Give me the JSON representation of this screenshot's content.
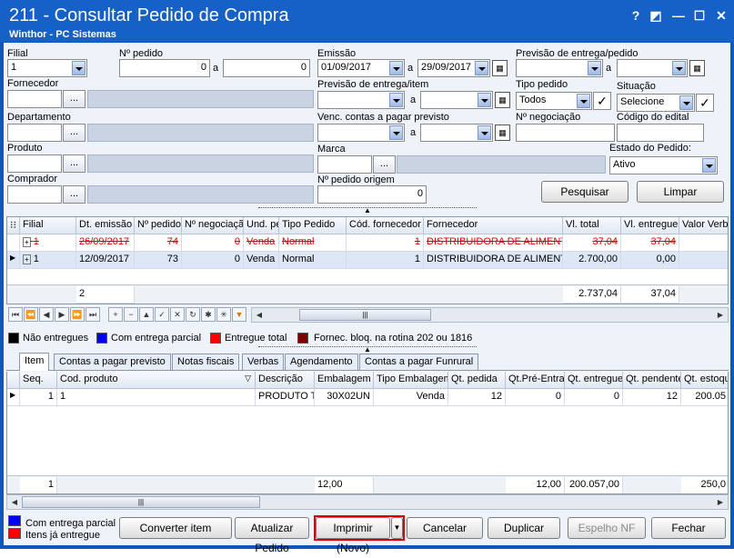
{
  "window": {
    "title": "211 - Consultar Pedido de Compra",
    "subtitle": "Winthor - PC Sistemas",
    "help": "?",
    "restore": "◩",
    "minimize": "—",
    "maximize": "☐",
    "close": "✕"
  },
  "filters": {
    "filial_label": "Filial",
    "filial_value": "1",
    "npedido_label": "Nº pedido",
    "npedido_from": "0",
    "npedido_to": "0",
    "a": "a",
    "emissao_label": "Emissão",
    "emissao_from": "01/09/2017",
    "emissao_to": "29/09/2017",
    "prev_entrega_pedido_label": "Previsão de entrega/pedido",
    "fornecedor_label": "Fornecedor",
    "prev_entrega_item_label": "Previsão de entrega/item",
    "tipo_pedido_label": "Tipo pedido",
    "tipo_pedido_value": "Todos",
    "situacao_label": "Situação",
    "situacao_value": "Selecione",
    "departamento_label": "Departamento",
    "venc_label": "Venc. contas a  pagar previsto",
    "nnegociacao_label": "Nº negociação",
    "cod_edital_label": "Código do edital",
    "produto_label": "Produto",
    "marca_label": "Marca",
    "estado_label": "Estado do Pedido:",
    "estado_value": "Ativo",
    "comprador_label": "Comprador",
    "npedido_origem_label": "Nº pedido origem",
    "npedido_origem_value": "0",
    "ellipsis": "...",
    "pesquisar": "Pesquisar",
    "limpar": "Limpar"
  },
  "orders": {
    "columns": [
      "Filial",
      "Dt. emissão",
      "Nº pedido",
      "Nº negociação",
      "Und. pe",
      "Tipo Pedido",
      "Cód. fornecedor",
      "Fornecedor",
      "Vl. total",
      "Vl. entregue",
      "Valor Verba"
    ],
    "rows": [
      {
        "filial": "1",
        "dt": "26/09/2017",
        "np": "74",
        "nn": "0",
        "und": "Venda",
        "tipo": "Normal",
        "cod": "1",
        "forn": "DISTRIBUIDORA DE ALIMENTO",
        "vt": "37,04",
        "ve": "37,04"
      },
      {
        "filial": "1",
        "dt": "12/09/2017",
        "np": "73",
        "nn": "0",
        "und": "Venda",
        "tipo": "Normal",
        "cod": "1",
        "forn": "DISTRIBUIDORA DE ALIMENTO",
        "vt": "2.700,00",
        "ve": "0,00"
      }
    ],
    "footer": {
      "count": "2",
      "total": "2.737,04",
      "entregue": "37,04"
    }
  },
  "legend": [
    {
      "label": "Não entregues",
      "color": "#000000"
    },
    {
      "label": "Com entrega parcial",
      "color": "#0000ff"
    },
    {
      "label": "Entregue total",
      "color": "#ff0000"
    },
    {
      "label": "Fornec. bloq. na rotina 202 ou 1816",
      "color": "#800000"
    }
  ],
  "tabs": [
    "Item",
    "Contas a pagar previsto",
    "Notas fiscais",
    "Verbas",
    "Agendamento",
    "Contas a pagar Funrural"
  ],
  "items": {
    "columns": [
      "Seq.",
      "Cod. produto",
      "Descrição",
      "Embalagem",
      "Tipo Embalagem",
      "Qt. pedida",
      "Qt.Pré-Entra",
      "Qt. entregue",
      "Qt. pendente",
      "Qt. estoque"
    ],
    "rows": [
      {
        "seq": "1",
        "cod": "1",
        "desc": "PRODUTO TI",
        "emb": "30X02UN",
        "tipo": "Venda",
        "qp": "12",
        "qpe": "0",
        "qe": "0",
        "qpend": "12",
        "qest": "200.05"
      }
    ],
    "footer": {
      "seq": "1",
      "emb": "12,00",
      "qpe": "12,00",
      "qe": "200.057,00",
      "qest": "250,0"
    }
  },
  "bottom_legend": [
    {
      "label": "Com entrega parcial",
      "color": "#0000ff"
    },
    {
      "label": "Itens já entregue",
      "color": "#ff0000"
    }
  ],
  "buttons": {
    "converter": "Converter item",
    "atualizar": "Atualizar Pedido",
    "imprimir": "Imprimir (Novo)",
    "cancelar": "Cancelar",
    "duplicar": "Duplicar",
    "espelho": "Espelho NF",
    "fechar": "Fechar"
  },
  "scroll_thumb": "|||"
}
